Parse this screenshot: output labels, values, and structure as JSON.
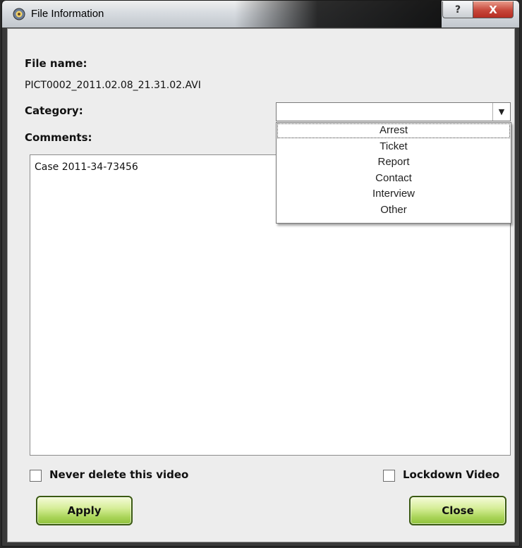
{
  "window": {
    "title": "File Information",
    "help_label": "?",
    "close_glyph": "X"
  },
  "form": {
    "file_name_label": "File name:",
    "file_name_value": "PICT0002_2011.02.08_21.31.02.AVI",
    "category_label": "Category:",
    "category_value": "",
    "comments_label": "Comments:",
    "comments_value": "Case 2011-34-73456"
  },
  "category_dropdown": {
    "options": [
      "Arrest",
      "Ticket",
      "Report",
      "Contact",
      "Interview",
      "Other"
    ],
    "focused_index": 0
  },
  "options": {
    "never_delete_label": "Never delete this video",
    "never_delete_checked": false,
    "lockdown_label": "Lockdown Video",
    "lockdown_checked": false
  },
  "buttons": {
    "apply_label": "Apply",
    "close_label": "Close"
  },
  "colors": {
    "button_green": "#a9d458",
    "titlebar_close_red": "#c7473a"
  }
}
